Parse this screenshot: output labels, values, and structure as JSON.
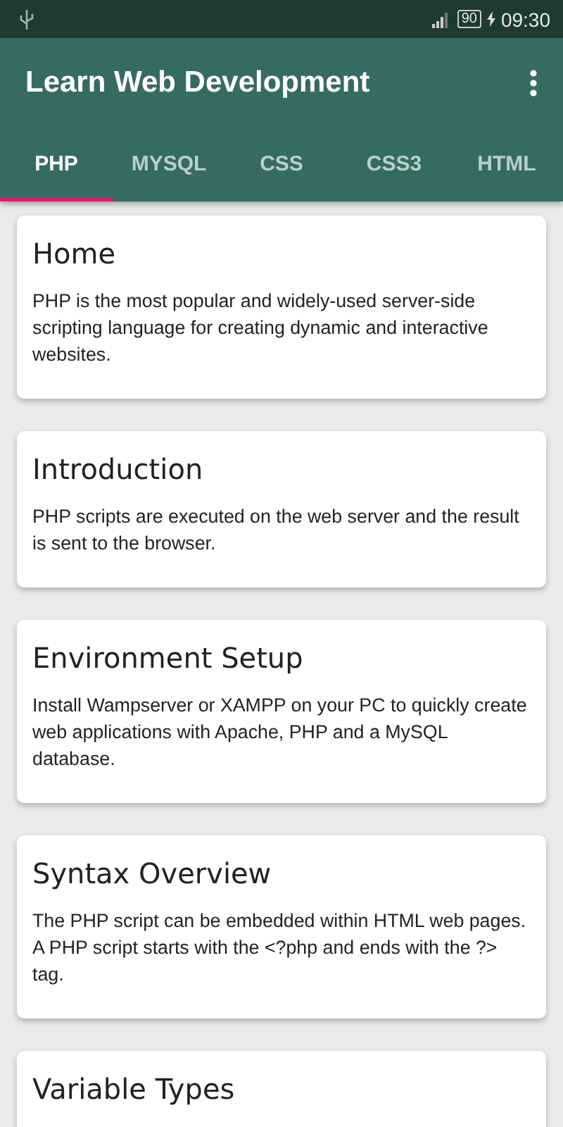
{
  "status_bar": {
    "battery": "90",
    "time": "09:30"
  },
  "toolbar": {
    "title": "Learn Web Development"
  },
  "tabs": [
    {
      "label": "PHP",
      "selected": true
    },
    {
      "label": "MYSQL",
      "selected": false
    },
    {
      "label": "CSS",
      "selected": false
    },
    {
      "label": "CSS3",
      "selected": false
    },
    {
      "label": "HTML",
      "selected": false
    }
  ],
  "cards": [
    {
      "title": "Home",
      "body": "PHP is the most popular and widely-used server-side scripting language for creating dynamic and interactive websites."
    },
    {
      "title": "Introduction",
      "body": "PHP scripts are executed on the web server and the result is sent to the browser."
    },
    {
      "title": "Environment Setup",
      "body": "Install Wampserver or XAMPP on your PC to quickly create web applications with Apache, PHP and a MySQL database."
    },
    {
      "title": "Syntax Overview",
      "body": "The PHP script can be embedded within HTML web pages. A PHP script starts with the <?php and ends with the ?> tag."
    },
    {
      "title": "Variable Types"
    }
  ]
}
